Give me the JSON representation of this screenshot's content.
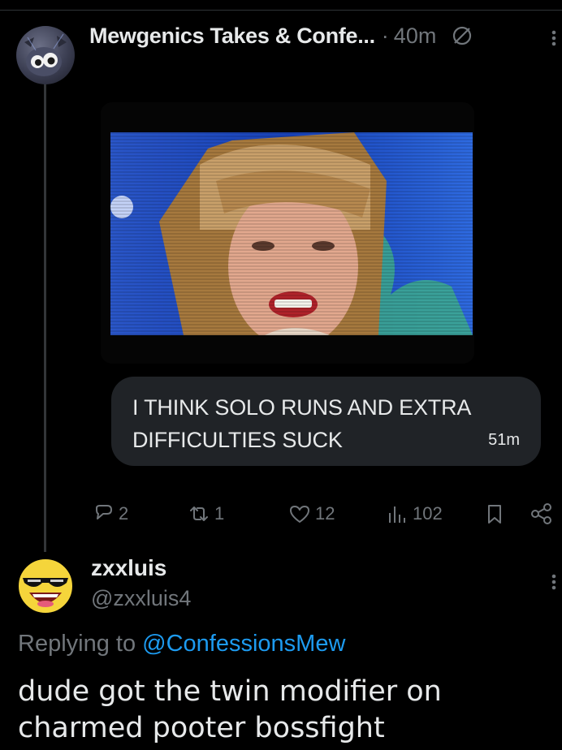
{
  "post": {
    "author_name": "Mewgenics Takes & Confe...",
    "separator": "·",
    "time": "40m",
    "message": {
      "text": "I THINK SOLO RUNS AND EXTRA DIFFICULTIES SUCK",
      "time": "51m"
    },
    "actions": {
      "replies": "2",
      "reposts": "1",
      "likes": "12",
      "views": "102"
    },
    "icons": [
      "no-entry-icon",
      "more-icon",
      "reply-icon",
      "repost-icon",
      "like-icon",
      "views-icon",
      "bookmark-icon",
      "share-icon"
    ]
  },
  "reply": {
    "author_name": "zxxluis",
    "handle": "@zxxluis4",
    "replying_label": "Replying to",
    "replying_to": "@ConfessionsMew",
    "text": "dude got the twin modifier on charmed pooter bossfight"
  },
  "colors": {
    "background": "#000000",
    "text": "#e7e9ea",
    "muted": "#71767b",
    "accent": "#1d9bf0",
    "bubble": "#202327"
  }
}
